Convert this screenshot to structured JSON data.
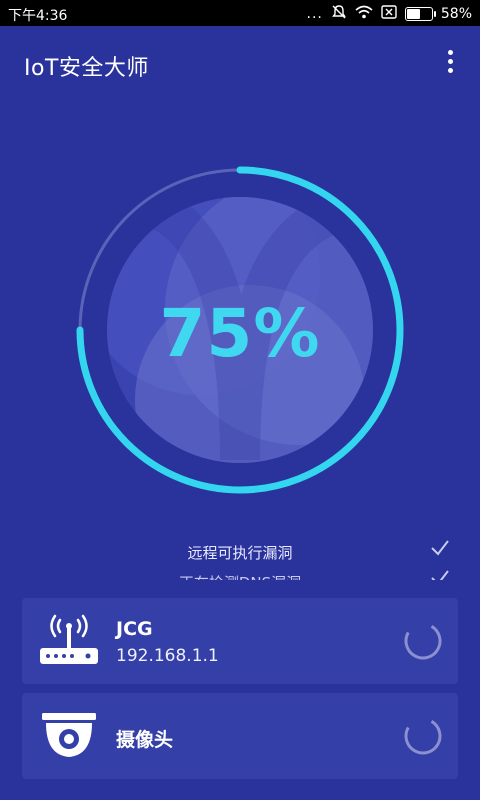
{
  "status_bar": {
    "time": "下午4:36",
    "dots": "...",
    "battery": "58%",
    "battery_level": 0.58,
    "icons": [
      "mute-icon",
      "wifi-icon",
      "sim-disabled-icon",
      "battery-icon"
    ]
  },
  "app_bar": {
    "title": "IoT安全大师",
    "menu_icon": "more-vert-icon"
  },
  "scan": {
    "progress_percent": 75,
    "progress_label": "75%",
    "items": [
      {
        "label": "远程可执行漏洞",
        "icon": "check-icon"
      },
      {
        "label": "正在检测DNS漏洞",
        "icon": "check-icon"
      }
    ]
  },
  "devices": [
    {
      "name": "JCG",
      "ip": "192.168.1.1",
      "icon": "router-icon",
      "status_icon": "loading-spinner-icon"
    },
    {
      "name": "摄像头",
      "ip": "",
      "icon": "camera-icon",
      "status_icon": "loading-spinner-icon"
    }
  ],
  "colors": {
    "background": "#2a329c",
    "card": "#353fa8",
    "accent": "#40d8f0",
    "track": "#5a63b8"
  }
}
